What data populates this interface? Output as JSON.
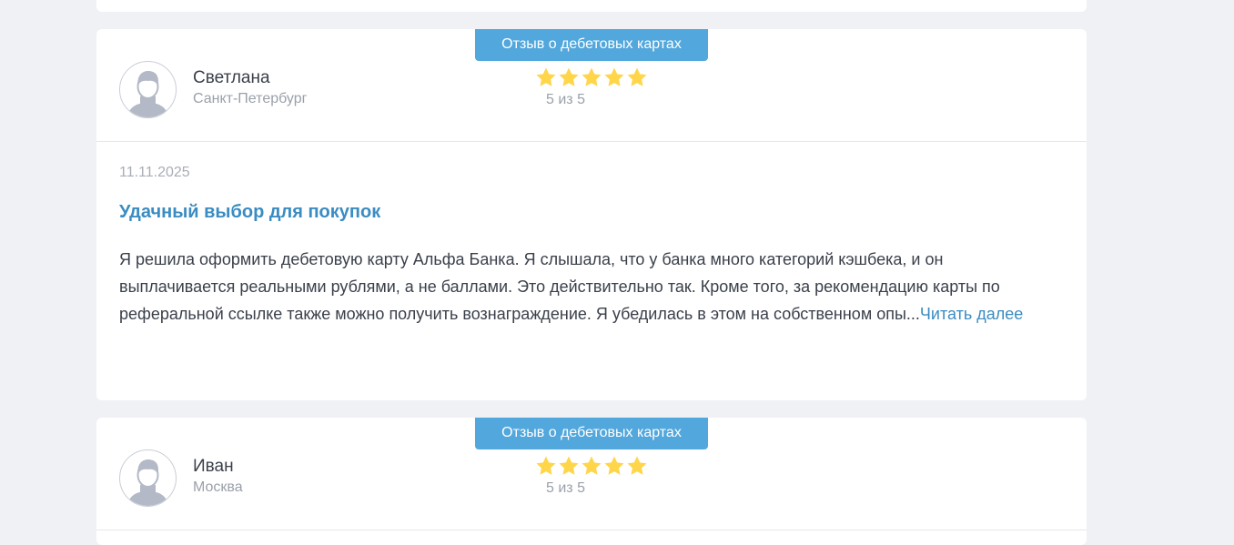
{
  "colors": {
    "accent": "#52a7dc",
    "link": "#3a8cc2",
    "star": "#ffd54a",
    "background": "#eff1f4"
  },
  "reviews": [
    {
      "category": "Отзыв о дебетовых картах",
      "author": "Светлана",
      "city": "Санкт-Петербург",
      "rating": 5,
      "rating_label": "5 из 5",
      "date": "11.11.2025",
      "title": "Удачный выбор для покупок",
      "text": "Я решила оформить дебетовую карту Альфа Банка. Я слышала, что у банка много категорий кэшбека, и он выплачивается реальными рублями, а не баллами. Это действительно так. Кроме того, за рекомендацию карты по реферальной ссылке также можно получить вознаграждение. Я убедилась в этом на собственном опы...",
      "read_more": "Читать далее"
    },
    {
      "category": "Отзыв о дебетовых картах",
      "author": "Иван",
      "city": "Москва",
      "rating": 5,
      "rating_label": "5 из 5"
    }
  ]
}
